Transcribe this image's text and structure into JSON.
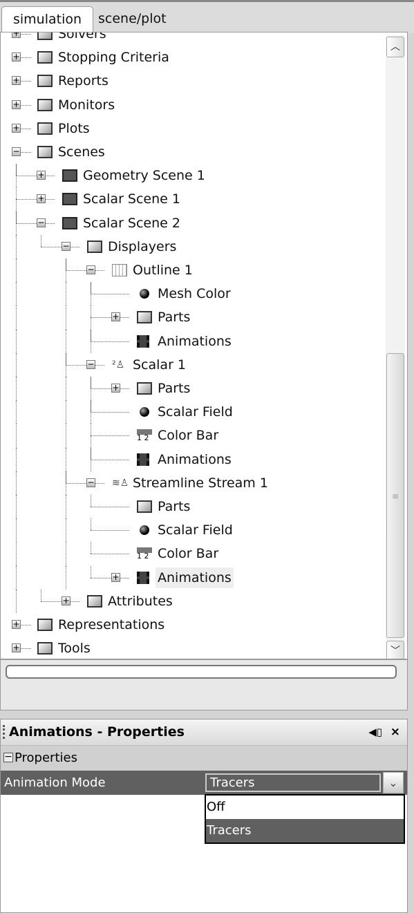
{
  "tabs": [
    {
      "label": "simulation",
      "active": true
    },
    {
      "label": "scene/plot",
      "active": false
    }
  ],
  "tree": [
    {
      "label": "Solvers",
      "level": 0,
      "expander": "plus",
      "icon": "folder"
    },
    {
      "label": "Stopping Criteria",
      "level": 0,
      "expander": "plus",
      "icon": "folder"
    },
    {
      "label": "Reports",
      "level": 0,
      "expander": "plus",
      "icon": "folder"
    },
    {
      "label": "Monitors",
      "level": 0,
      "expander": "plus",
      "icon": "folder"
    },
    {
      "label": "Plots",
      "level": 0,
      "expander": "plus",
      "icon": "folder"
    },
    {
      "label": "Scenes",
      "level": 0,
      "expander": "minus",
      "icon": "folder"
    },
    {
      "label": "Geometry Scene 1",
      "level": 1,
      "expander": "plus",
      "icon": "scene"
    },
    {
      "label": "Scalar Scene 1",
      "level": 1,
      "expander": "plus",
      "icon": "scene"
    },
    {
      "label": "Scalar Scene 2",
      "level": 1,
      "expander": "minus",
      "icon": "scene"
    },
    {
      "label": "Displayers",
      "level": 2,
      "expander": "minus",
      "icon": "folder"
    },
    {
      "label": "Outline 1",
      "level": 3,
      "expander": "minus",
      "icon": "outline"
    },
    {
      "label": "Mesh Color",
      "level": 4,
      "expander": "none",
      "icon": "ball"
    },
    {
      "label": "Parts",
      "level": 4,
      "expander": "plus",
      "icon": "folder"
    },
    {
      "label": "Animations",
      "level": 4,
      "expander": "none",
      "icon": "film"
    },
    {
      "label": "Scalar 1",
      "level": 3,
      "expander": "minus",
      "icon": "scalar"
    },
    {
      "label": "Parts",
      "level": 4,
      "expander": "plus",
      "icon": "folder"
    },
    {
      "label": "Scalar Field",
      "level": 4,
      "expander": "none",
      "icon": "ball"
    },
    {
      "label": "Color Bar",
      "level": 4,
      "expander": "none",
      "icon": "colorbar"
    },
    {
      "label": "Animations",
      "level": 4,
      "expander": "none",
      "icon": "film"
    },
    {
      "label": "Streamline Stream 1",
      "level": 3,
      "expander": "minus",
      "icon": "streamline"
    },
    {
      "label": "Parts",
      "level": 4,
      "expander": "none",
      "icon": "folder"
    },
    {
      "label": "Scalar Field",
      "level": 4,
      "expander": "none",
      "icon": "ball"
    },
    {
      "label": "Color Bar",
      "level": 4,
      "expander": "none",
      "icon": "colorbar"
    },
    {
      "label": "Animations",
      "level": 4,
      "expander": "plus",
      "icon": "film",
      "selected": true
    },
    {
      "label": "Attributes",
      "level": 2,
      "expander": "plus",
      "icon": "folder"
    },
    {
      "label": "Representations",
      "level": 0,
      "expander": "plus",
      "icon": "folder"
    },
    {
      "label": "Tools",
      "level": 0,
      "expander": "plus",
      "icon": "folder"
    }
  ],
  "properties_panel": {
    "title": "Animations - Properties",
    "pin_icon": "pin-icon",
    "close_icon": "close-icon",
    "close_glyph": "×",
    "group": "Properties",
    "property_name": "Animation Mode",
    "property_value": "Tracers",
    "options": [
      "Off",
      "Tracers"
    ],
    "selected_option": "Tracers"
  },
  "colors": {
    "selection": "#606060",
    "highlight": "#eeeeee"
  }
}
